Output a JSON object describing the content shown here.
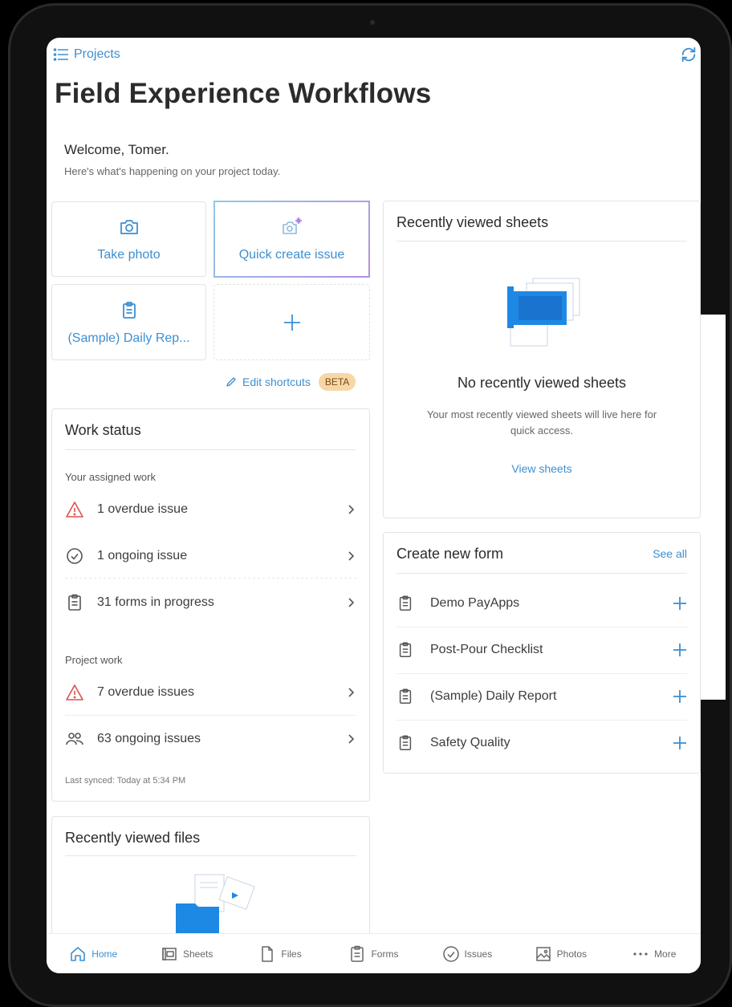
{
  "colors": {
    "accent": "#3d8fd1",
    "warning_icon": "#d9534f",
    "beta_bg": "#f7d7a8"
  },
  "header": {
    "back_label": "Projects",
    "back_icon": "list-icon",
    "sync_icon": "sync-icon",
    "title": "Field Experience Workflows"
  },
  "welcome": {
    "greeting": "Welcome, Tomer.",
    "subtitle": "Here's what's happening on your project today."
  },
  "shortcuts": {
    "items": [
      {
        "label": "Take photo",
        "icon": "camera-icon"
      },
      {
        "label": "Quick create issue",
        "icon": "camera-sparkle-icon"
      },
      {
        "label": "(Sample) Daily Rep...",
        "icon": "clipboard-icon"
      },
      {
        "label": "",
        "icon": "plus-icon"
      }
    ],
    "edit_label": "Edit shortcuts",
    "beta_badge": "BETA"
  },
  "work_status": {
    "title": "Work status",
    "assigned_label": "Your assigned work",
    "assigned": [
      {
        "label": "1 overdue issue",
        "icon": "warning-icon"
      },
      {
        "label": "1 ongoing issue",
        "icon": "check-circle-icon"
      },
      {
        "label": "31 forms in progress",
        "icon": "clipboard-icon"
      }
    ],
    "project_label": "Project work",
    "project": [
      {
        "label": "7 overdue issues",
        "icon": "warning-icon"
      },
      {
        "label": "63 ongoing issues",
        "icon": "people-icon"
      }
    ],
    "last_synced": "Last synced: Today at 5:34 PM"
  },
  "recent_files": {
    "title": "Recently viewed files"
  },
  "recent_sheets": {
    "title": "Recently viewed sheets",
    "empty_title": "No recently viewed sheets",
    "empty_subtitle": "Your most recently viewed sheets will live here for quick access.",
    "link": "View sheets"
  },
  "create_form": {
    "title": "Create new form",
    "see_all": "See all",
    "items": [
      {
        "label": "Demo PayApps"
      },
      {
        "label": "Post-Pour Checklist"
      },
      {
        "label": "(Sample) Daily Report"
      },
      {
        "label": "Safety Quality"
      }
    ]
  },
  "tabbar": {
    "items": [
      {
        "label": "Home",
        "icon": "home-icon",
        "active": true
      },
      {
        "label": "Sheets",
        "icon": "sheets-icon"
      },
      {
        "label": "Files",
        "icon": "file-icon"
      },
      {
        "label": "Forms",
        "icon": "clipboard-icon"
      },
      {
        "label": "Issues",
        "icon": "check-circle-icon"
      },
      {
        "label": "Photos",
        "icon": "photo-icon"
      },
      {
        "label": "More",
        "icon": "more-dots-icon"
      }
    ]
  }
}
